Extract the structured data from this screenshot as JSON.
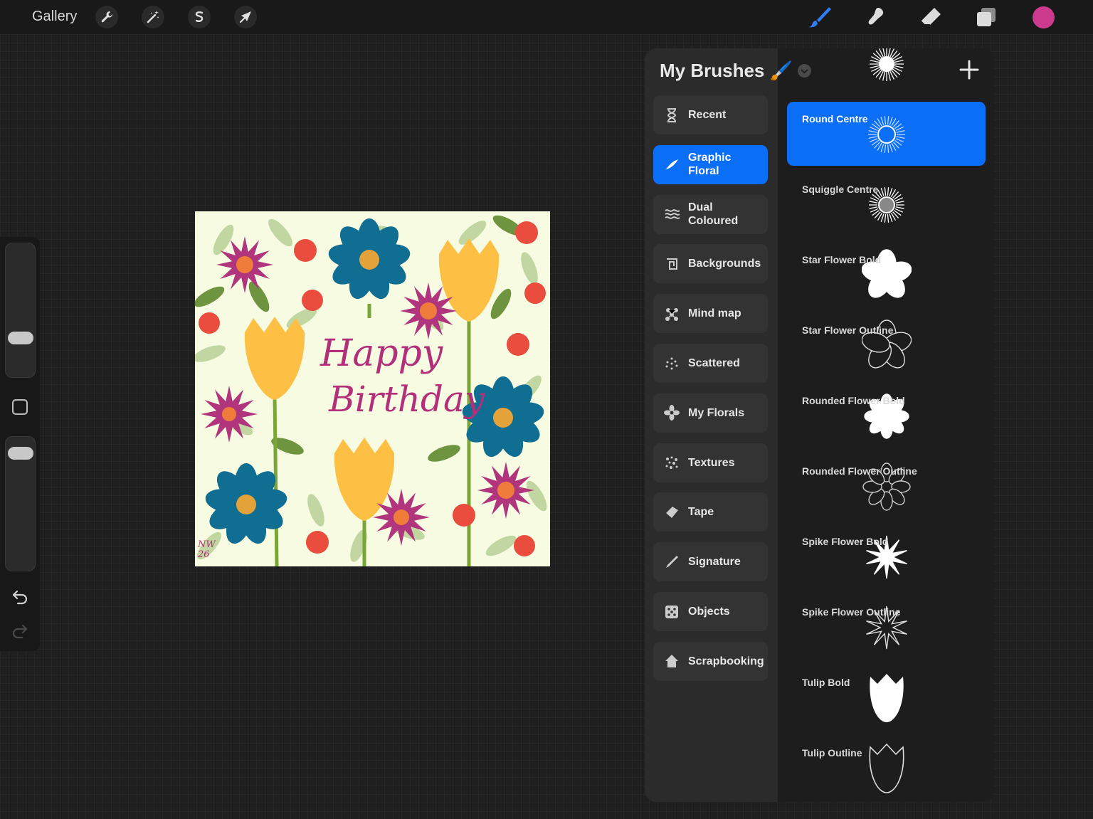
{
  "toolbar": {
    "gallery_label": "Gallery",
    "left_tools": [
      "wrench-icon",
      "magic-wand-icon",
      "selection-s-icon",
      "transform-arrow-icon"
    ],
    "right_tools": [
      "brush-icon",
      "smudge-icon",
      "eraser-icon",
      "layers-icon"
    ],
    "current_color": "#cc3a8e",
    "active_tool_color": "#2f7df6"
  },
  "sidebar": {
    "size_slider_level": 0.73,
    "opacity_slider_level": 0.94,
    "undo_icon": "undo-icon",
    "redo_icon": "redo-icon"
  },
  "artwork": {
    "text_line1": "Happy",
    "text_line2": "Birthday",
    "signature": "NW 26",
    "text_color": "#b2307a",
    "background": "#f6fbe1"
  },
  "brush_panel": {
    "title": "My Brushes 🖌️",
    "categories": [
      {
        "label": "Recent",
        "icon": "hourglass-icon",
        "active": false
      },
      {
        "label": "Graphic Floral",
        "icon": "stroke-icon",
        "active": true
      },
      {
        "label": "Dual Coloured",
        "icon": "waves-icon",
        "active": false
      },
      {
        "label": "Backgrounds",
        "icon": "swirl-grid-icon",
        "active": false
      },
      {
        "label": "Mind map",
        "icon": "network-icon",
        "active": false
      },
      {
        "label": "Scattered",
        "icon": "dots-icon",
        "active": false
      },
      {
        "label": "My Florals",
        "icon": "flower-icon",
        "active": false
      },
      {
        "label": "Textures",
        "icon": "texture-icon",
        "active": false
      },
      {
        "label": "Tape",
        "icon": "tape-icon",
        "active": false
      },
      {
        "label": "Signature",
        "icon": "pen-icon",
        "active": false
      },
      {
        "label": "Objects",
        "icon": "dice-icon",
        "active": false
      },
      {
        "label": "Scrapbooking",
        "icon": "house-icon",
        "active": false
      }
    ],
    "brushes": [
      {
        "name": "",
        "stamp": "sunburst",
        "active": false
      },
      {
        "name": "Round Centre",
        "stamp": "ring-burst",
        "active": true
      },
      {
        "name": "Squiggle Centre",
        "stamp": "squiggle-burst",
        "active": false
      },
      {
        "name": "Star Flower Bold",
        "stamp": "star-flower-bold",
        "active": false
      },
      {
        "name": "Star Flower Outline",
        "stamp": "star-flower-outline",
        "active": false
      },
      {
        "name": "Rounded Flower Bold",
        "stamp": "rounded-flower-bold",
        "active": false
      },
      {
        "name": "Rounded Flower Outline",
        "stamp": "rounded-flower-outline",
        "active": false
      },
      {
        "name": "Spike Flower Bold",
        "stamp": "spike-flower-bold",
        "active": false
      },
      {
        "name": "Spike Flower Outline",
        "stamp": "spike-flower-outline",
        "active": false
      },
      {
        "name": "Tulip Bold",
        "stamp": "tulip-bold",
        "active": false
      },
      {
        "name": "Tulip Outline",
        "stamp": "tulip-outline",
        "active": false
      }
    ]
  }
}
